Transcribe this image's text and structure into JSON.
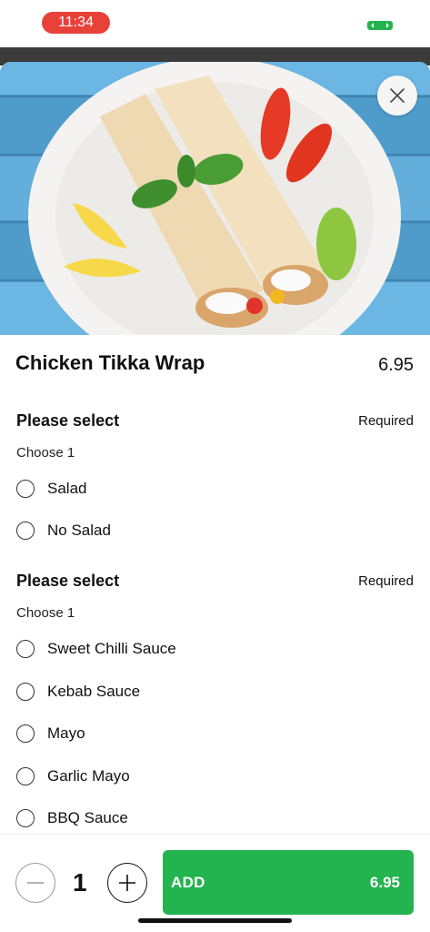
{
  "status_bar": {
    "time": "11:34",
    "time_pill_color": "#e8413a",
    "battery_color": "#23b34f"
  },
  "hero_image": {
    "description_icon": "wrap-food-photo"
  },
  "item": {
    "title": "Chicken Tikka Wrap",
    "price": "6.95"
  },
  "groups": [
    {
      "title": "Please select",
      "required": "Required",
      "subtitle": "Choose 1",
      "options": [
        "Salad",
        "No Salad"
      ]
    },
    {
      "title": "Please select",
      "required": "Required",
      "subtitle": "Choose 1",
      "options": [
        "Sweet Chilli Sauce",
        "Kebab Sauce",
        "Mayo",
        "Garlic Mayo",
        "BBQ Sauce"
      ]
    }
  ],
  "quantity": {
    "value": "1"
  },
  "add_button": {
    "label": "ADD",
    "price": "6.95",
    "color": "#23b34f"
  }
}
